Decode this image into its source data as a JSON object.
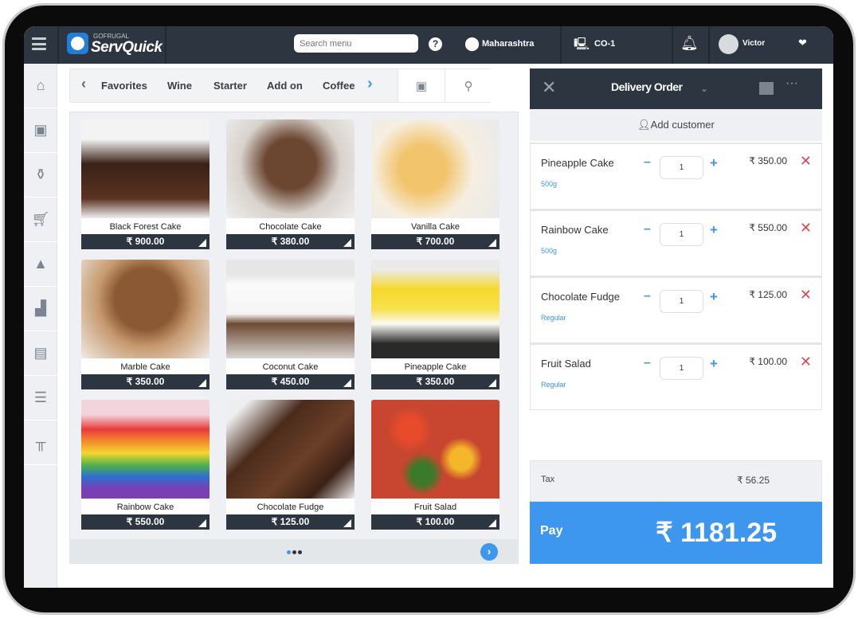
{
  "header": {
    "brand_top": "GOFRUGAL",
    "brand": "ServQuick",
    "search_placeholder": "Search menu",
    "help": "?",
    "location": "Maharashtra",
    "counter": "CO-1",
    "user": "Victor"
  },
  "sidebar": {
    "items": [
      "home-icon",
      "catalog-icon",
      "trolley-icon",
      "cart-icon",
      "purchase-icon",
      "reports-icon",
      "clipboard-icon",
      "settings-sliders-icon",
      "table-icon"
    ]
  },
  "categories": {
    "items": [
      "Favorites",
      "Wine",
      "Starter",
      "Add on",
      "Coffee"
    ]
  },
  "menu": {
    "items": [
      {
        "name": "Black Forest Cake",
        "price": "₹ 900.00"
      },
      {
        "name": "Chocolate Cake",
        "price": "₹ 380.00"
      },
      {
        "name": "Vanilla Cake",
        "price": "₹ 700.00"
      },
      {
        "name": "Marble Cake",
        "price": "₹ 350.00"
      },
      {
        "name": "Coconut Cake",
        "price": "₹ 450.00"
      },
      {
        "name": "Pineapple Cake",
        "price": "₹ 350.00"
      },
      {
        "name": "Rainbow Cake",
        "price": "₹ 550.00"
      },
      {
        "name": "Chocolate Fudge",
        "price": "₹ 125.00"
      },
      {
        "name": "Fruit Salad",
        "price": "₹ 100.00"
      }
    ]
  },
  "order": {
    "title": "Delivery Order",
    "add_customer": "Add customer",
    "items": [
      {
        "name": "Pineapple Cake",
        "variant": "500g",
        "qty": "1",
        "amount": "₹ 350.00"
      },
      {
        "name": "Rainbow Cake",
        "variant": "500g",
        "qty": "1",
        "amount": "₹ 550.00"
      },
      {
        "name": "Chocolate Fudge",
        "variant": "Regular",
        "qty": "1",
        "amount": "₹ 125.00"
      },
      {
        "name": "Fruit Salad",
        "variant": "Regular",
        "qty": "1",
        "amount": "₹ 100.00"
      }
    ],
    "tax_label": "Tax",
    "tax": "₹ 56.25",
    "pay_label": "Pay",
    "total": "₹ 1181.25"
  },
  "colors": {
    "header": "#2d3640",
    "accent": "#3d97ee",
    "delete": "#e0474c"
  }
}
